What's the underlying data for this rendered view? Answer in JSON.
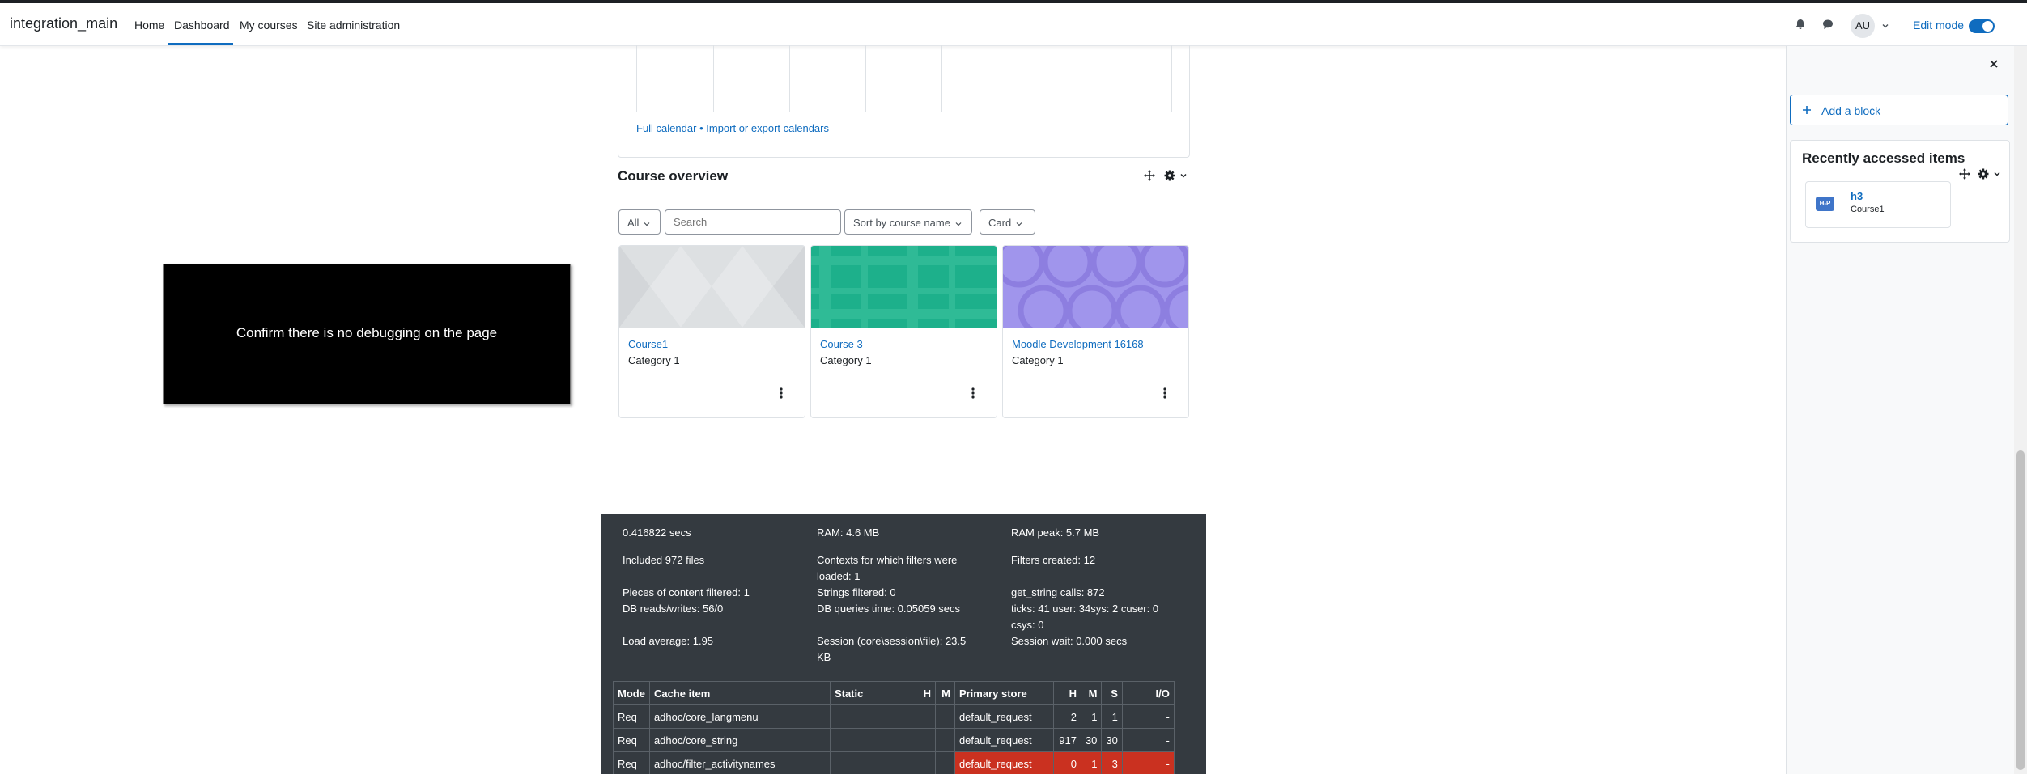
{
  "navbar": {
    "brand": "integration_main",
    "links": [
      "Home",
      "Dashboard",
      "My courses",
      "Site administration"
    ],
    "active_link": "Dashboard",
    "user_initials": "AU",
    "edit_mode_label": "Edit mode",
    "edit_mode_on": true
  },
  "calendar": {
    "full_calendar_link": "Full calendar",
    "separator": "•",
    "import_export_link": "Import or export calendars"
  },
  "course_overview": {
    "title": "Course overview",
    "filter_label": "All",
    "search_placeholder": "Search",
    "sort_label": "Sort by course name",
    "view_label": "Card",
    "courses": [
      {
        "name": "Course1",
        "category": "Category 1",
        "pattern_color": "#d7dadd"
      },
      {
        "name": "Course 3",
        "category": "Category 1",
        "pattern_color": "#1fb08c"
      },
      {
        "name": "Moodle Development 16168",
        "category": "Category 1",
        "pattern_color": "#9a8de8"
      }
    ]
  },
  "overlay": {
    "message": "Confirm there is no debugging on the page"
  },
  "performance": {
    "col1": [
      "0.416822 secs",
      "Included 972 files",
      "Pieces of content filtered: 1",
      "DB reads/writes: 56/0",
      "Load average: 1.95"
    ],
    "col2": [
      "RAM: 4.6 MB",
      "Contexts for which filters were loaded: 1",
      "Strings filtered: 0",
      "DB queries time: 0.05059 secs",
      "Session (core\\session\\file): 23.5 KB"
    ],
    "col3": [
      "RAM peak: 5.7 MB",
      "Filters created: 12",
      "get_string calls: 872",
      "ticks: 41 user: 34sys: 2 cuser: 0 csys: 0",
      "Session wait: 0.000 secs"
    ],
    "cache_table": {
      "headers": [
        "Mode",
        "Cache item",
        "Static",
        "H",
        "M",
        "Primary store",
        "H",
        "M",
        "S",
        "I/O"
      ],
      "rows": [
        [
          "Req",
          "adhoc/core_langmenu",
          "",
          "",
          "",
          "default_request",
          "2",
          "1",
          "1",
          "-"
        ],
        [
          "Req",
          "adhoc/core_string",
          "",
          "",
          "",
          "default_request",
          "917",
          "30",
          "30",
          "-"
        ],
        [
          "Req",
          "adhoc/filter_activitynames",
          "",
          "",
          "",
          "default_request",
          "0",
          "1",
          "3",
          "-"
        ]
      ]
    }
  },
  "drawer": {
    "add_block_label": "Add a block",
    "recent_title": "Recently accessed items",
    "recent_items": [
      {
        "icon_text": "H-P",
        "name": "h3",
        "course": "Course1"
      }
    ]
  }
}
